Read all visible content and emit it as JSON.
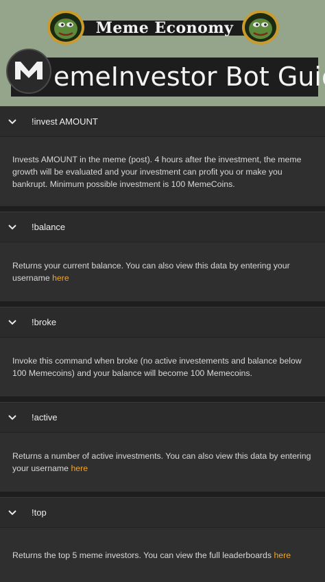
{
  "header": {
    "banner_title": "Meme Economy",
    "bot_title": "emeInvestor Bot Guide"
  },
  "commands": [
    {
      "title": "!invest AMOUNT",
      "body": "Invests AMOUNT in the meme (post). 4 hours after the investment, the meme growth will be evaluated and your investment can profit you or make you bankrupt. Minimum possible investment is 100 MemeCoins.",
      "link": ""
    },
    {
      "title": "!balance",
      "body": "Returns your current balance. You can also view this data by entering your username",
      "link": "here"
    },
    {
      "title": "!broke",
      "body": "Invoke this command when broke (no active investements and balance below 100 Memecoins) and your balance will become 100 Memecoins.",
      "link": ""
    },
    {
      "title": "!active",
      "body": "Returns a number of active investments. You can also view this data by entering your username",
      "link": "here"
    },
    {
      "title": "!top",
      "body": "Returns the top 5 meme investors. You can view the full leaderboards",
      "link": "here"
    }
  ],
  "colors": {
    "header_bg": "#94a58c",
    "link": "#f0a52a",
    "panel": "#2f2f2f",
    "head": "#2b2b2b"
  },
  "icons": [
    "pepe-icon",
    "memeinvestor-logo",
    "chevron-down-icon"
  ]
}
